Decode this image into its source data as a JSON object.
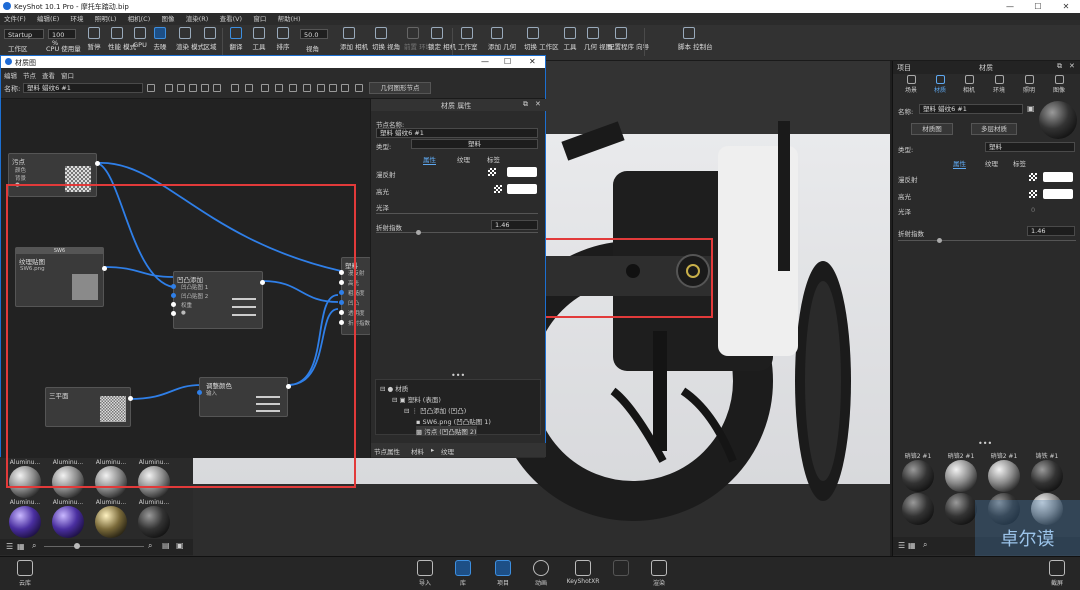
{
  "app": {
    "title": "KeyShot 10.1 Pro - 摩托车踏动.bip",
    "window_controls": [
      "—",
      "☐",
      "✕"
    ]
  },
  "menubar": [
    "文件(F)",
    "编辑(E)",
    "环境",
    "照明(L)",
    "相机(C)",
    "图像",
    "渲染(R)",
    "查看(V)",
    "窗口",
    "帮助(H)"
  ],
  "ribbon": {
    "workspace_value": "Startup",
    "zoom_value": "100 %",
    "fps_value": "50.0",
    "buttons": [
      "工作区",
      "CPU 使用量",
      "暂停",
      "性能 模式",
      "GPU",
      "去噪",
      "渲染 模式",
      "区域",
      "翻译",
      "工具",
      "排序",
      "视角",
      "添加 相机",
      "切换 视角",
      "前置 环境",
      "锁定 相机",
      "工作室",
      "添加 几何",
      "切换 工作区",
      "工具",
      "几何 视图",
      "配置程序 向导",
      "脚本 控制台"
    ]
  },
  "material_window": {
    "title": "材质图",
    "menu": [
      "编辑",
      "节点",
      "查看",
      "窗口"
    ],
    "name_label": "名称:",
    "name_value": "塑料 蜡纹6 #1",
    "geometry_button": "几何图形节点",
    "nodes": {
      "stain": {
        "title": "污点",
        "rows": [
          "颜色",
          "背景",
          "●"
        ]
      },
      "texture": {
        "header": "SW6",
        "title": "纹理贴图",
        "sub": "SW6.png"
      },
      "bump_add": {
        "title": "凹凸添加",
        "rows": [
          "凹凸贴图 1",
          "凹凸贴图 2",
          "权重",
          "●"
        ]
      },
      "material": {
        "title": "塑料",
        "rows": [
          "漫反射",
          "高光",
          "粗糙度",
          "凹凸",
          "透明度",
          "折射指数"
        ]
      },
      "triplanar": {
        "title": "三平面"
      },
      "color_adjust": {
        "title": "调整颜色",
        "rows": [
          "输入"
        ]
      }
    },
    "attributes": {
      "title": "材质 属性",
      "node_name_label": "节点名称:",
      "node_name_value": "塑料 蜡纹6 #1",
      "type_label": "类型:",
      "type_value": "塑料",
      "tabs": [
        "属性",
        "纹理",
        "标签"
      ],
      "props": [
        {
          "label": "漫反射"
        },
        {
          "label": "高光"
        },
        {
          "label": "光泽"
        },
        {
          "label": "折射指数",
          "value": "1.46"
        }
      ],
      "tree_root": "材质",
      "tree": [
        "塑料 (表面)",
        "凹凸添加 (凹凸)",
        "SW6.png (凹凸贴图 1)",
        "污点 (凹凸贴图 2)"
      ],
      "bottom_tabs": [
        "节点属性",
        "材料",
        "纹理"
      ]
    }
  },
  "library": {
    "items": [
      {
        "label": "Aluminu...",
        "style": "silver"
      },
      {
        "label": "Aluminu...",
        "style": "silver"
      },
      {
        "label": "Aluminu...",
        "style": "silver"
      },
      {
        "label": "Aluminu...",
        "style": "silver"
      },
      {
        "label": "Aluminu...",
        "style": "purple"
      },
      {
        "label": "Aluminu...",
        "style": "purple"
      },
      {
        "label": "Aluminu...",
        "style": "gold"
      },
      {
        "label": "Aluminu...",
        "style": "dark"
      }
    ]
  },
  "right_panel": {
    "header": "材质",
    "section": "项目",
    "tabs": [
      "场景",
      "材质",
      "相机",
      "环境",
      "照明",
      "图像"
    ],
    "name_label": "名称:",
    "name_value": "塑料 蜡纹6 #1",
    "material_graph_button": "材质图",
    "multi_layer_button": "多层材质",
    "type_label": "类型:",
    "type_value": "塑料",
    "subtabs": [
      "属性",
      "纹理",
      "标签"
    ],
    "props": [
      {
        "label": "漫反射"
      },
      {
        "label": "高光"
      },
      {
        "label": "光泽",
        "value": "0"
      },
      {
        "label": "折射指数",
        "value": "1.46"
      }
    ],
    "materials": [
      {
        "label": "硝铬2 #1",
        "style": "dark"
      },
      {
        "label": "硝铬2 #1",
        "style": "silver"
      },
      {
        "label": "硝铬2 #1",
        "style": "silver"
      },
      {
        "label": "铸铁 #1",
        "style": "dark"
      },
      {
        "label": "",
        "style": "dark"
      },
      {
        "label": "",
        "style": "dark"
      },
      {
        "label": "",
        "style": "dark"
      },
      {
        "label": "",
        "style": "silver"
      }
    ]
  },
  "bottombar": {
    "left_label": "云库",
    "buttons": [
      "导入",
      "库",
      "项目",
      "动画",
      "KeyShotXR",
      "",
      "渲染"
    ],
    "right_label": "截屏"
  },
  "watermark": "卓尔谟"
}
